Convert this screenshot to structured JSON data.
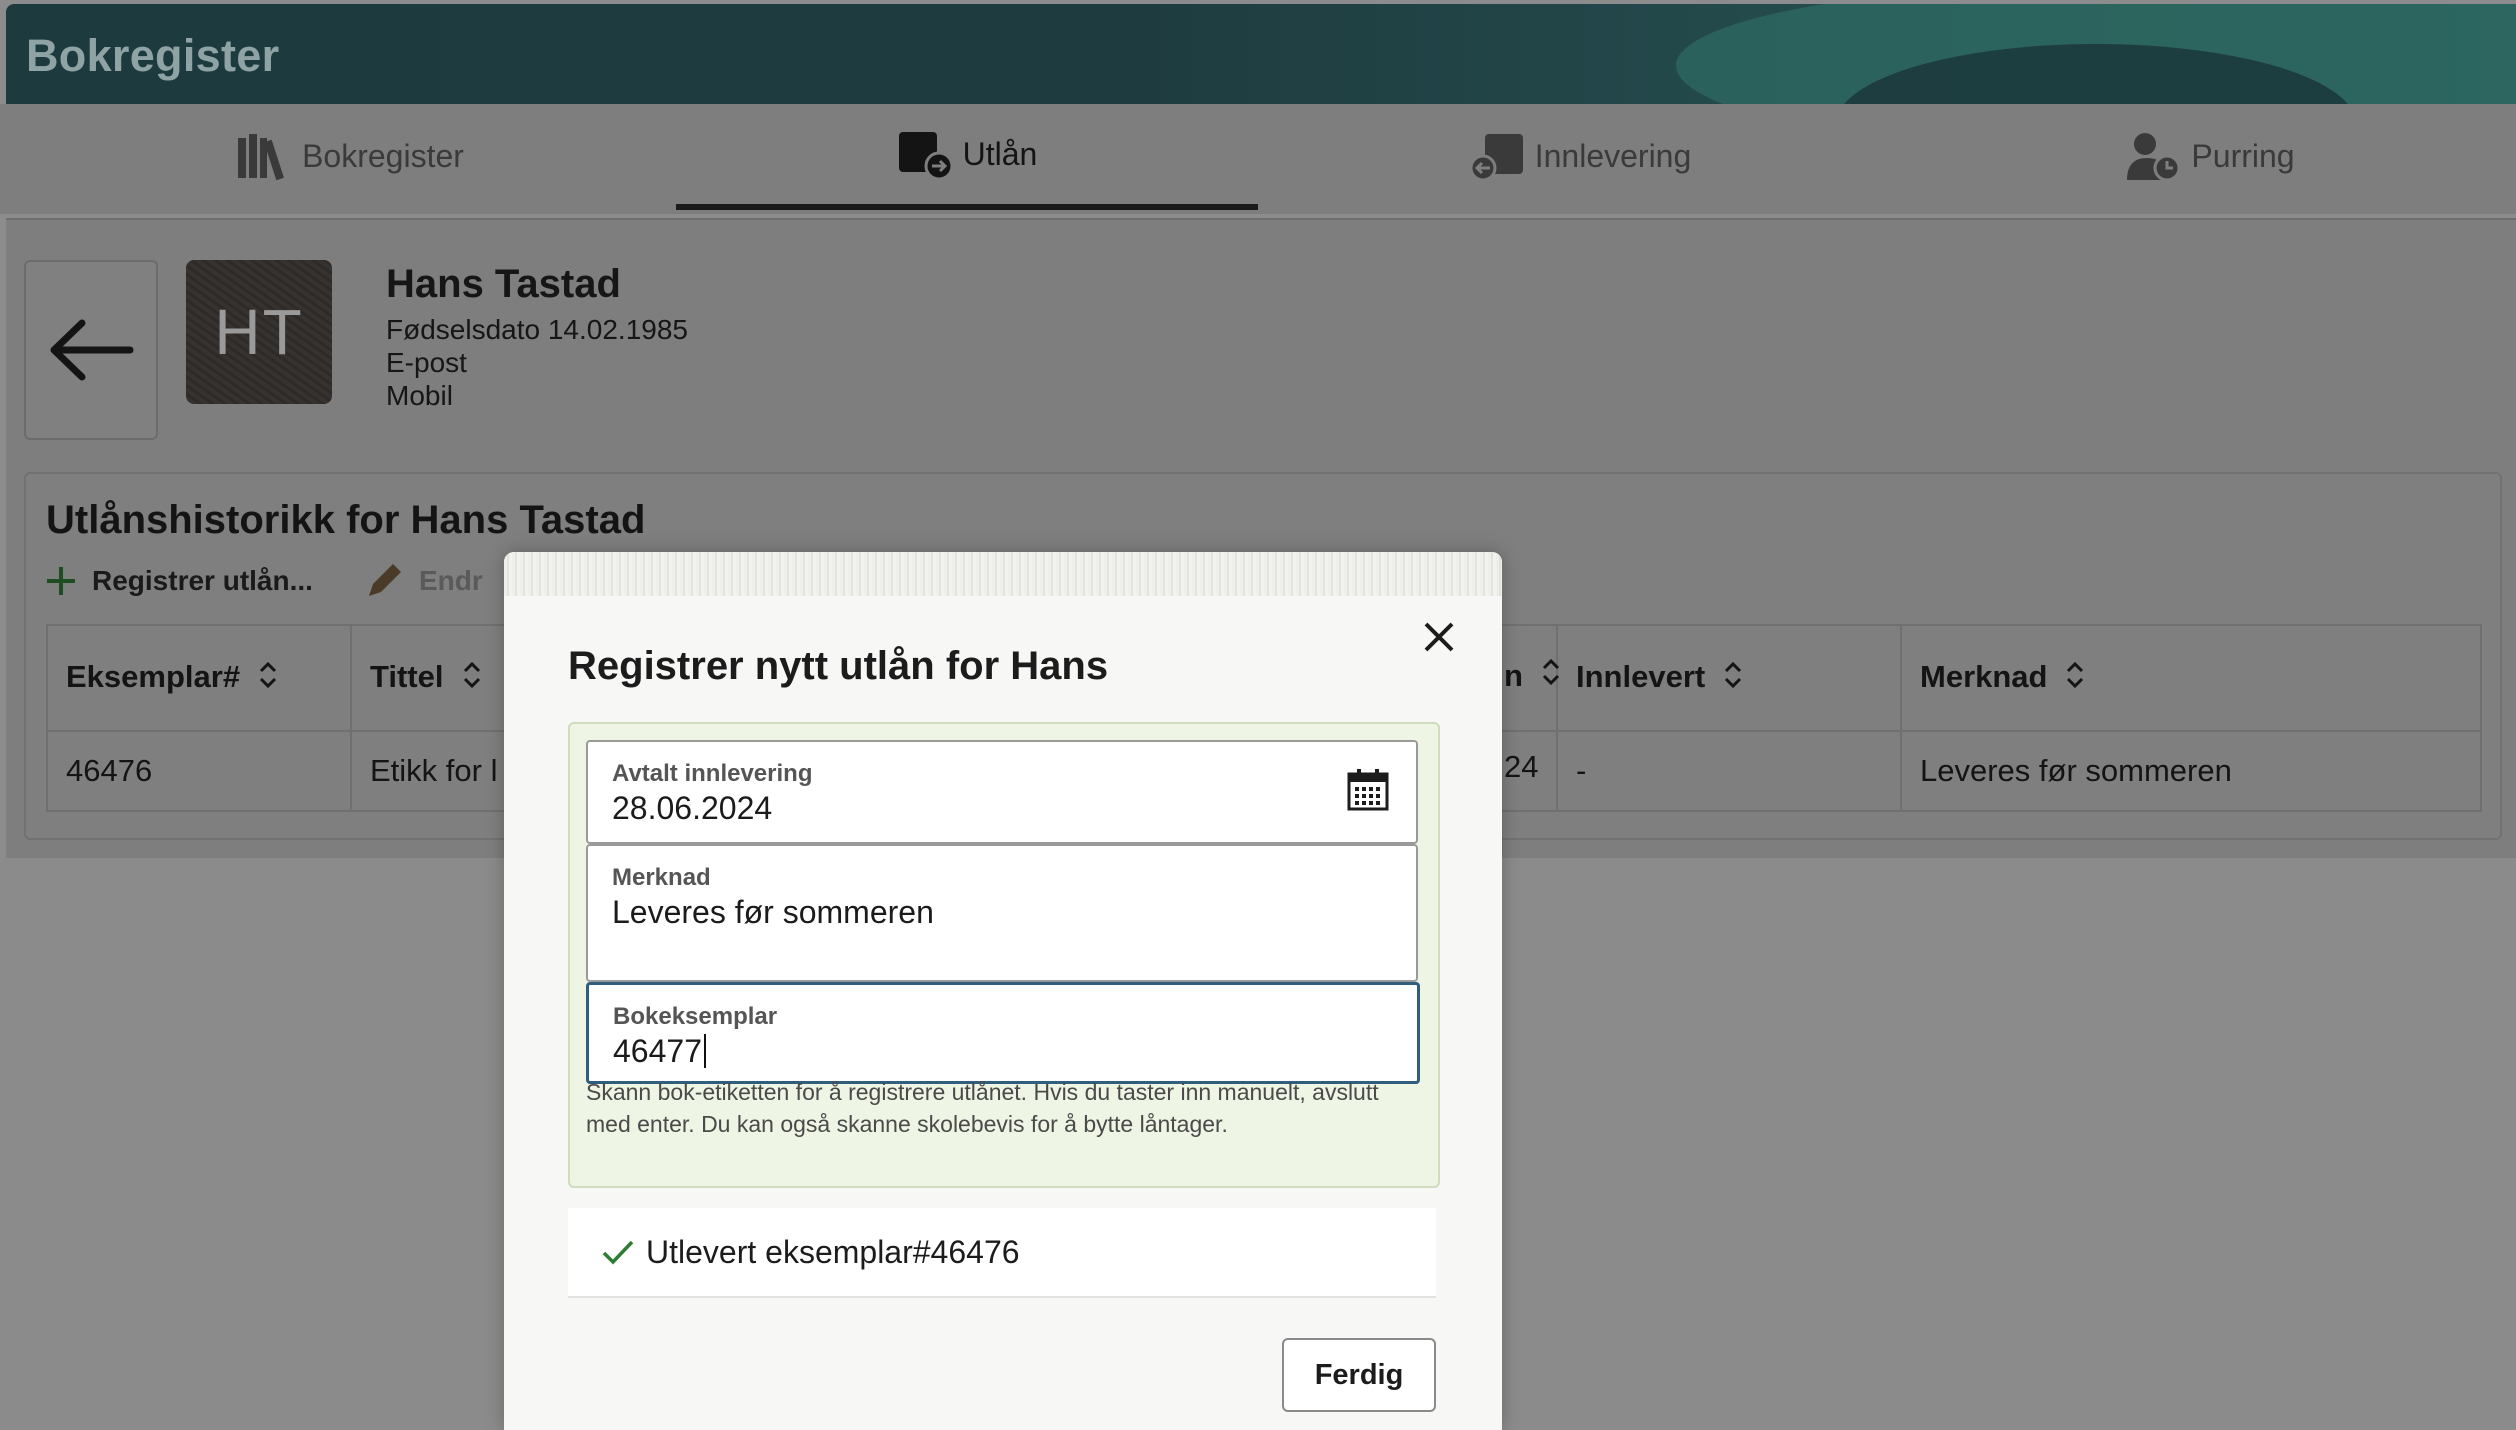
{
  "app": {
    "title": "Bokregister"
  },
  "tabs": [
    {
      "label": "Bokregister",
      "icon": "books-icon",
      "active": false
    },
    {
      "label": "Utlån",
      "icon": "lend-book-icon",
      "active": true
    },
    {
      "label": "Innlevering",
      "icon": "return-book-icon",
      "active": false
    },
    {
      "label": "Purring",
      "icon": "user-clock-icon",
      "active": false
    }
  ],
  "person": {
    "initials": "HT",
    "name": "Hans Tastad",
    "birth": "Fødselsdato 14.02.1985",
    "email_label": "E-post",
    "mobile_label": "Mobil"
  },
  "history": {
    "title": "Utlånshistorikk for Hans Tastad",
    "register_button": "Registrer utlån...",
    "edit_button": "Endr",
    "columns": [
      "Eksemplar#",
      "Tittel",
      "n",
      "Innlevert",
      "Merknad"
    ],
    "rows": [
      {
        "eksemplar": "46476",
        "tittel": "Etikk for l",
        "dato": "24",
        "innlevert": "-",
        "merknad": "Leveres før sommeren"
      }
    ]
  },
  "modal": {
    "title": "Registrer nytt utlån for Hans",
    "due_label": "Avtalt innlevering",
    "due_value": "28.06.2024",
    "note_label": "Merknad",
    "note_value": "Leveres før sommeren",
    "copy_label": "Bokeksemplar",
    "copy_value": "46477",
    "hint": "Skann bok-etiketten for å registrere utlånet. Hvis du taster inn manuelt, avslutt med enter. Du kan også skanne skolebevis for å bytte låntager.",
    "delivered": "Utlevert eksemplar#46476",
    "done_button": "Ferdig"
  },
  "colors": {
    "header": "#1d3a3e",
    "accent_green": "#2e7d32",
    "focus_border": "#2f5f7c",
    "panel_bg": "#eef5e4"
  }
}
